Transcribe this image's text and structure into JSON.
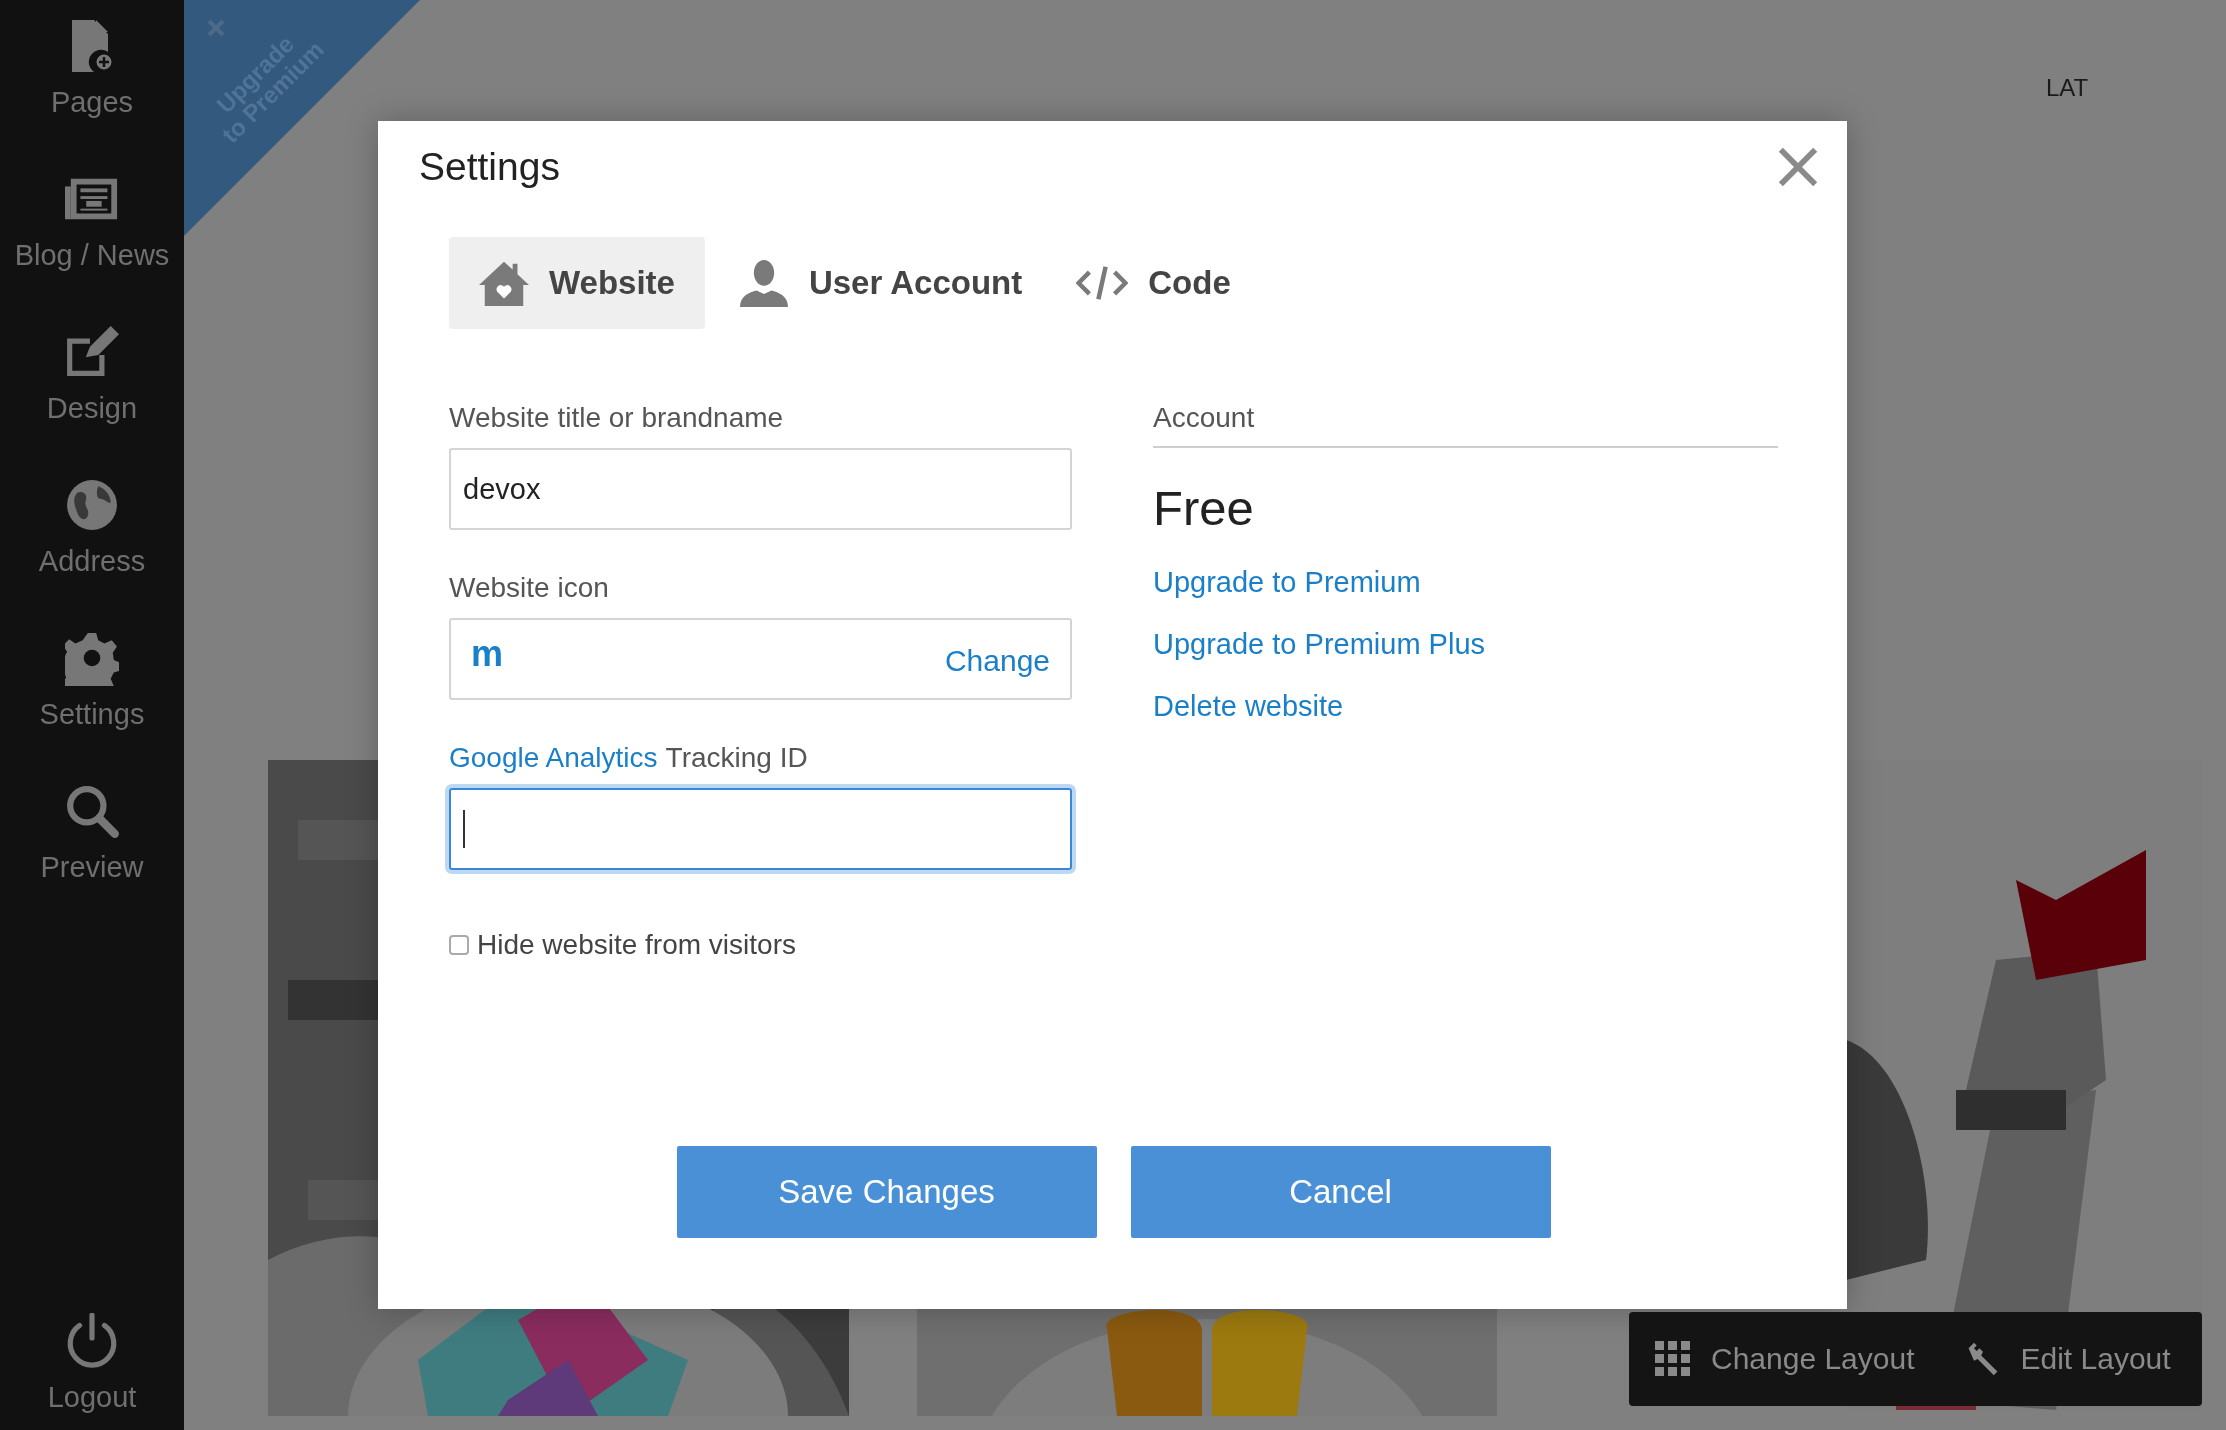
{
  "sidebar": {
    "items": [
      {
        "label": "Pages",
        "kind": "page"
      },
      {
        "label": "Blog / News",
        "kind": "news"
      },
      {
        "label": "Design",
        "kind": "edit"
      },
      {
        "label": "Address",
        "kind": "globe"
      },
      {
        "label": "Settings",
        "kind": "gear"
      },
      {
        "label": "Preview",
        "kind": "search"
      }
    ],
    "footer": {
      "label": "Logout",
      "kind": "power"
    }
  },
  "banner": {
    "lines": [
      "Upgrade",
      "to Premium"
    ]
  },
  "header": {
    "language": "LAT"
  },
  "dialog": {
    "title": "Settings",
    "tabs": [
      {
        "label": "Website",
        "kind": "house",
        "selected": true
      },
      {
        "label": "User Account",
        "kind": "user",
        "selected": false
      },
      {
        "label": "Code",
        "kind": "code",
        "selected": false
      }
    ],
    "fields": [
      {
        "kind": "text",
        "label": "Website title or brandname",
        "value": "devox",
        "focused": false
      },
      {
        "kind": "icon",
        "label": "Website icon",
        "glyph": "m",
        "action": "Change",
        "focused": false
      },
      {
        "kind": "text",
        "label_link": "Google Analytics",
        "label": "Tracking ID",
        "focused": true
      }
    ],
    "checkbox": {
      "label": "Hide website from visitors",
      "checked": false
    },
    "account": {
      "heading": "Account",
      "plan": "Free",
      "links": [
        "Upgrade to Premium",
        "Upgrade to Premium Plus",
        "Delete website"
      ]
    },
    "buttons": [
      "Save Changes",
      "Cancel"
    ]
  },
  "toolbar": [
    {
      "label": "Change Layout",
      "kind": "grid"
    },
    {
      "label": "Edit Layout",
      "kind": "wrench"
    }
  ]
}
